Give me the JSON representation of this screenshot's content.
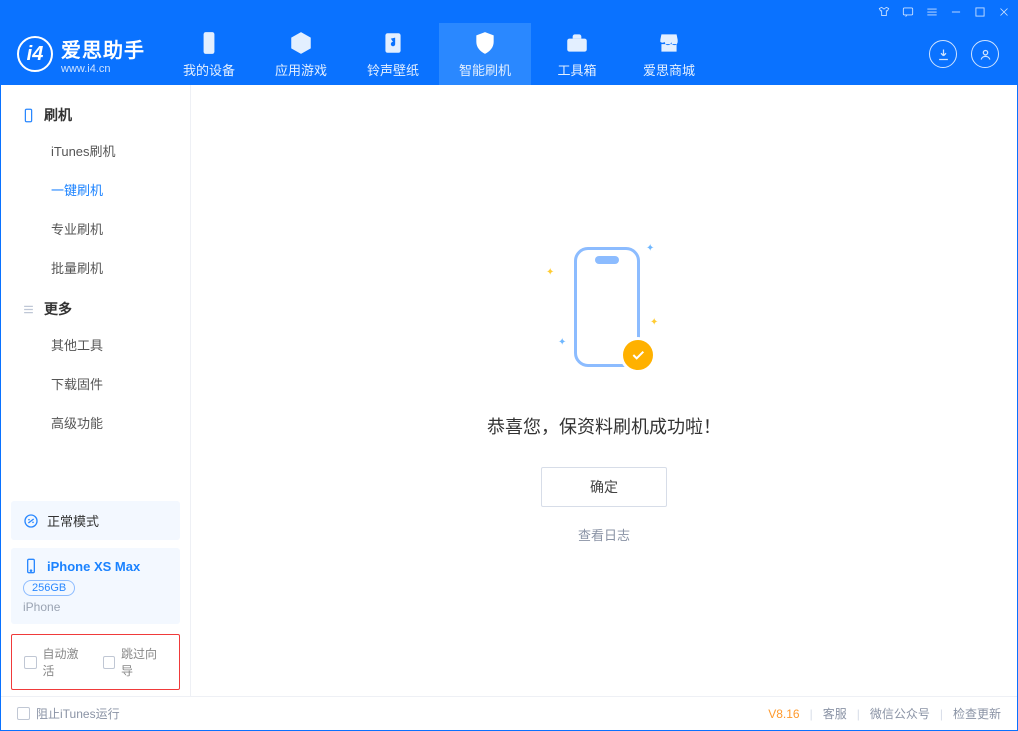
{
  "brand": {
    "name": "爱思助手",
    "domain": "www.i4.cn"
  },
  "tabs": [
    {
      "label": "我的设备"
    },
    {
      "label": "应用游戏"
    },
    {
      "label": "铃声壁纸"
    },
    {
      "label": "智能刷机"
    },
    {
      "label": "工具箱"
    },
    {
      "label": "爱思商城"
    }
  ],
  "sidebar": {
    "section1": {
      "title": "刷机",
      "items": [
        "iTunes刷机",
        "一键刷机",
        "专业刷机",
        "批量刷机"
      ]
    },
    "section2": {
      "title": "更多",
      "items": [
        "其他工具",
        "下载固件",
        "高级功能"
      ]
    },
    "mode_label": "正常模式",
    "device": {
      "name": "iPhone XS Max",
      "capacity": "256GB",
      "type": "iPhone"
    },
    "checks": {
      "auto_activate": "自动激活",
      "skip_guide": "跳过向导"
    }
  },
  "main": {
    "success": "恭喜您，保资料刷机成功啦！",
    "ok": "确定",
    "view_log": "查看日志"
  },
  "status": {
    "stop_itunes": "阻止iTunes运行",
    "version": "V8.16",
    "links": [
      "客服",
      "微信公众号",
      "检查更新"
    ]
  }
}
